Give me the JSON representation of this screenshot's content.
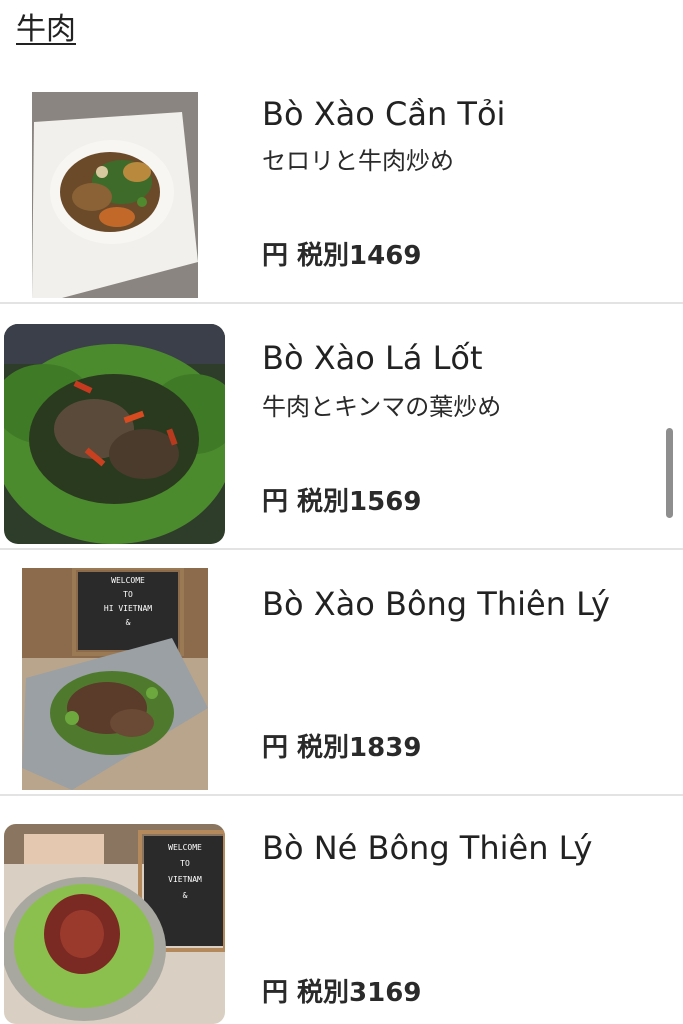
{
  "category": {
    "title": "牛肉"
  },
  "items": [
    {
      "name": "Bò Xào Cần Tỏi",
      "description": "セロリと牛肉炒め",
      "price": "円 税別1469"
    },
    {
      "name": "Bò Xào Lá Lốt",
      "description": "牛肉とキンマの葉炒め",
      "price": "円 税別1569"
    },
    {
      "name": "Bò Xào Bông Thiên Lý",
      "description": "",
      "price": "円 税別1839"
    },
    {
      "name": "Bò Né Bông Thiên Lý",
      "description": "",
      "price": "円 税別3169"
    }
  ],
  "photo_signs": {
    "sign_3": [
      "WELCOME",
      "TO",
      "HI VIETNAM",
      "&"
    ],
    "sign_4": [
      "WELCOME",
      "TO",
      "VIETNAM",
      "&"
    ]
  },
  "colors": {
    "divider": "#e3e3e3",
    "scrollbar": "#8e8e8e",
    "text": "#222222"
  }
}
